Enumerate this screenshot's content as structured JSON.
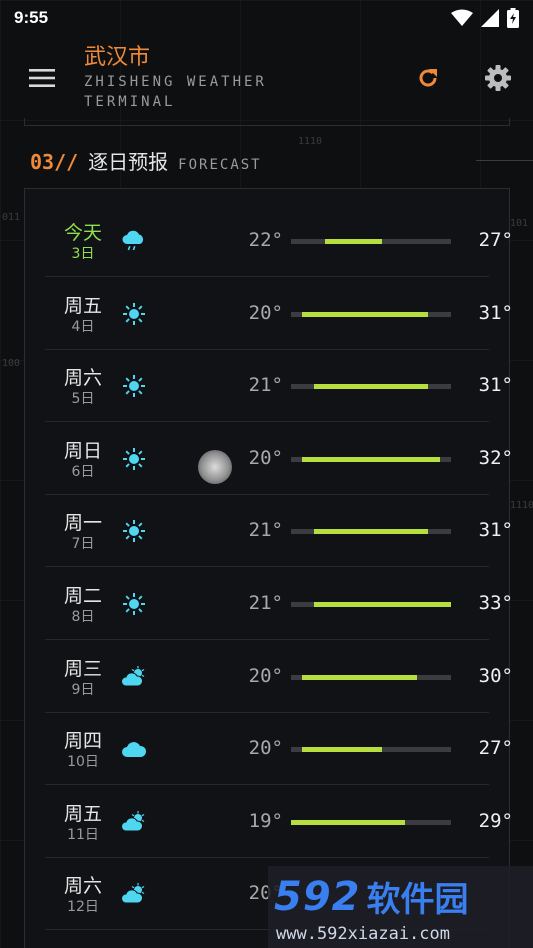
{
  "status_bar": {
    "time": "9:55"
  },
  "app_bar": {
    "city": "武汉市",
    "subtitle": "ZHISHENG WEATHER\nTERMINAL"
  },
  "section": {
    "number": "03//",
    "title": "逐日预报",
    "title_en": "FORECAST"
  },
  "background_tags": [
    "1110",
    "011",
    "101",
    "100",
    "1110"
  ],
  "forecast": {
    "range_min": 19,
    "range_max": 33,
    "days": [
      {
        "name": "今天",
        "date": "3日",
        "icon": "rain-cloud-icon",
        "low": "22°",
        "high": "27°",
        "low_v": 22,
        "high_v": 27,
        "today": true
      },
      {
        "name": "周五",
        "date": "4日",
        "icon": "sun-icon",
        "low": "20°",
        "high": "31°",
        "low_v": 20,
        "high_v": 31
      },
      {
        "name": "周六",
        "date": "5日",
        "icon": "sun-icon",
        "low": "21°",
        "high": "31°",
        "low_v": 21,
        "high_v": 31
      },
      {
        "name": "周日",
        "date": "6日",
        "icon": "sun-icon",
        "low": "20°",
        "high": "32°",
        "low_v": 20,
        "high_v": 32
      },
      {
        "name": "周一",
        "date": "7日",
        "icon": "sun-icon",
        "low": "21°",
        "high": "31°",
        "low_v": 21,
        "high_v": 31
      },
      {
        "name": "周二",
        "date": "8日",
        "icon": "sun-icon",
        "low": "21°",
        "high": "33°",
        "low_v": 21,
        "high_v": 33
      },
      {
        "name": "周三",
        "date": "9日",
        "icon": "partly-cloudy-icon",
        "low": "20°",
        "high": "30°",
        "low_v": 20,
        "high_v": 30
      },
      {
        "name": "周四",
        "date": "10日",
        "icon": "cloud-icon",
        "low": "20°",
        "high": "27°",
        "low_v": 20,
        "high_v": 27
      },
      {
        "name": "周五",
        "date": "11日",
        "icon": "partly-cloudy-icon",
        "low": "19°",
        "high": "29°",
        "low_v": 19,
        "high_v": 29
      },
      {
        "name": "周六",
        "date": "12日",
        "icon": "partly-cloudy-icon",
        "low": "20°",
        "high": "",
        "low_v": 20,
        "high_v": null
      }
    ]
  },
  "watermark": {
    "brand_num": "592",
    "brand_cn": "软件园",
    "url": "www.592xiazai.com"
  },
  "colors": {
    "accent": "#ef8a3a",
    "today": "#8ee04f",
    "bar": "#b5de3e",
    "icon": "#4fd6f0",
    "background": "#0e0f11"
  }
}
